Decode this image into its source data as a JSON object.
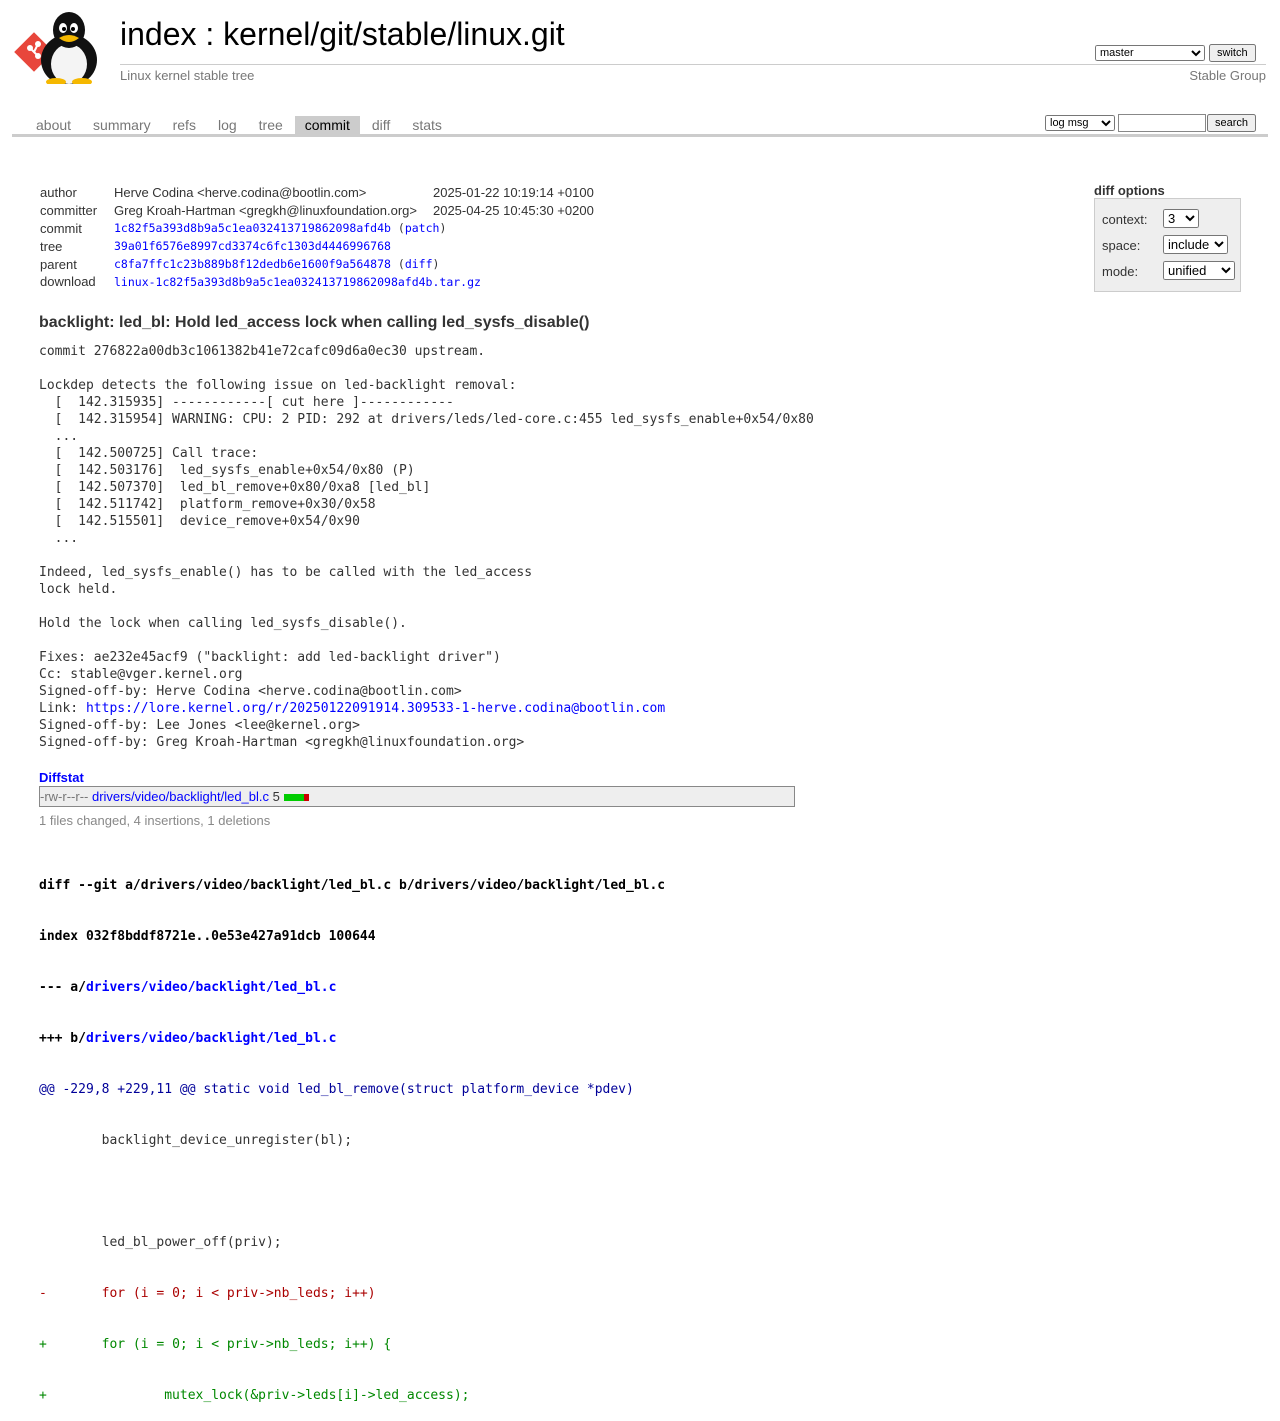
{
  "header": {
    "index_label": "index",
    "separator": " : ",
    "repo_path": "kernel/git/stable/linux.git",
    "subtitle": "Linux kernel stable tree",
    "branch": "master",
    "switch_label": "switch",
    "owner": "Stable Group"
  },
  "tabs": [
    {
      "label": "about"
    },
    {
      "label": "summary"
    },
    {
      "label": "refs"
    },
    {
      "label": "log"
    },
    {
      "label": "tree"
    },
    {
      "label": "commit",
      "active": true
    },
    {
      "label": "diff"
    },
    {
      "label": "stats"
    }
  ],
  "search": {
    "type": "log msg",
    "value": "",
    "button": "search"
  },
  "commit_info": {
    "author_label": "author",
    "author": "Herve Codina <herve.codina@bootlin.com>",
    "author_date": "2025-01-22 10:19:14 +0100",
    "committer_label": "committer",
    "committer": "Greg Kroah-Hartman <gregkh@linuxfoundation.org>",
    "committer_date": "2025-04-25 10:45:30 +0200",
    "commit_label": "commit",
    "commit": "1c82f5a393d8b9a5c1ea032413719862098afd4b",
    "patch_link": "patch",
    "tree_label": "tree",
    "tree": "39a01f6576e8997cd3374c6fc1303d4446996768",
    "parent_label": "parent",
    "parent": "c8fa7ffc1c23b889b8f12dedb6e1600f9a564878",
    "diff_link": "diff",
    "download_label": "download",
    "download": "linux-1c82f5a393d8b9a5c1ea032413719862098afd4b.tar.gz"
  },
  "diff_options": {
    "title": "diff options",
    "context_label": "context:",
    "context": "3",
    "space_label": "space:",
    "space": "include",
    "mode_label": "mode:",
    "mode": "unified"
  },
  "message": {
    "subject": "backlight: led_bl: Hold led_access lock when calling led_sysfs_disable()",
    "body_before_link": "commit 276822a00db3c1061382b41e72cafc09d6a0ec30 upstream.\n\nLockdep detects the following issue on led-backlight removal:\n  [  142.315935] ------------[ cut here ]------------\n  [  142.315954] WARNING: CPU: 2 PID: 292 at drivers/leds/led-core.c:455 led_sysfs_enable+0x54/0x80\n  ...\n  [  142.500725] Call trace:\n  [  142.503176]  led_sysfs_enable+0x54/0x80 (P)\n  [  142.507370]  led_bl_remove+0x80/0xa8 [led_bl]\n  [  142.511742]  platform_remove+0x30/0x58\n  [  142.515501]  device_remove+0x54/0x90\n  ...\n\nIndeed, led_sysfs_enable() has to be called with the led_access\nlock held.\n\nHold the lock when calling led_sysfs_disable().\n\nFixes: ae232e45acf9 (\"backlight: add led-backlight driver\")\nCc: stable@vger.kernel.org\nSigned-off-by: Herve Codina <herve.codina@bootlin.com>\nLink: ",
    "link": "https://lore.kernel.org/r/20250122091914.309533-1-herve.codina@bootlin.com",
    "body_after_link": "\nSigned-off-by: Lee Jones <lee@kernel.org>\nSigned-off-by: Greg Kroah-Hartman <gregkh@linuxfoundation.org>"
  },
  "diffstat": {
    "header": "Diffstat",
    "mode": "-rw-r--r--",
    "file": "drivers/video/backlight/led_bl.c",
    "count": "5",
    "insertions_fraction": 0.8,
    "deletions_fraction": 0.2,
    "summary": "1 files changed, 4 insertions, 1 deletions"
  },
  "diff": {
    "lines": [
      {
        "type": "head",
        "text": "diff --git a/drivers/video/backlight/led_bl.c b/drivers/video/backlight/led_bl.c"
      },
      {
        "type": "head",
        "text": "index 032f8bddf8721e..0e53e427a91dcb 100644"
      },
      {
        "type": "head",
        "prefix": "--- a/",
        "link": "drivers/video/backlight/led_bl.c"
      },
      {
        "type": "head",
        "prefix": "+++ b/",
        "link": "drivers/video/backlight/led_bl.c"
      },
      {
        "type": "hunk",
        "text": "@@ -229,8 +229,11 @@ static void led_bl_remove(struct platform_device *pdev)"
      },
      {
        "type": "ctx",
        "text": " \tbacklight_device_unregister(bl);"
      },
      {
        "type": "ctx",
        "text": " "
      },
      {
        "type": "ctx",
        "text": " \tled_bl_power_off(priv);"
      },
      {
        "type": "del",
        "text": "-\tfor (i = 0; i < priv->nb_leds; i++)"
      },
      {
        "type": "add",
        "text": "+\tfor (i = 0; i < priv->nb_leds; i++) {"
      },
      {
        "type": "add",
        "text": "+\t\tmutex_lock(&priv->leds[i]->led_access);"
      }
    ]
  },
  "colors": {
    "accent_link": "#0000ff",
    "add_green": "#008000",
    "del_red": "#aa0000",
    "hunk_blue": "#000099",
    "tab_active_bg": "#cccccc",
    "logo_red": "#e8463b"
  }
}
